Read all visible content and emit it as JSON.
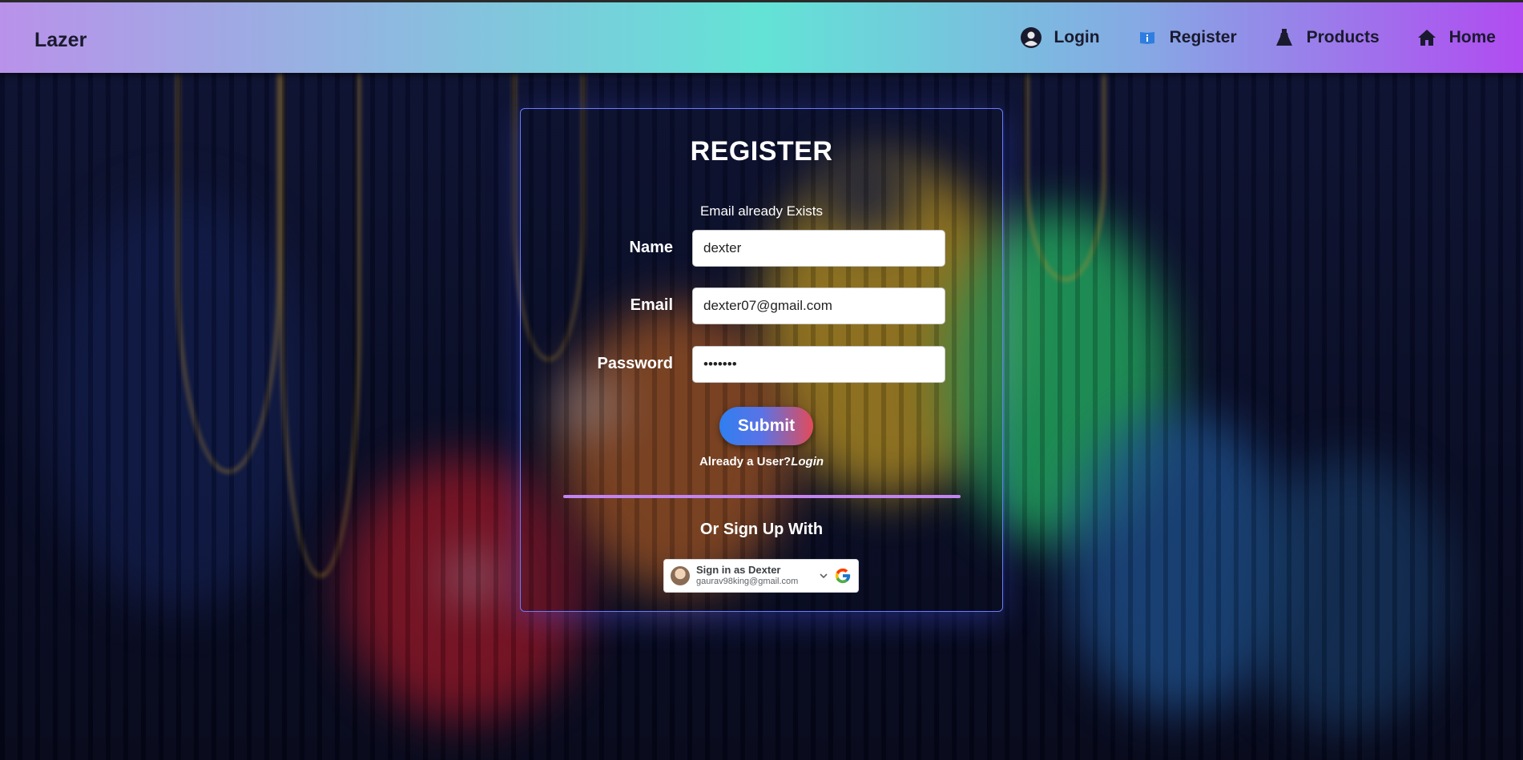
{
  "navbar": {
    "brand": "Lazer",
    "items": [
      {
        "label": "Login",
        "icon": "user-circle-icon"
      },
      {
        "label": "Register",
        "icon": "info-book-icon"
      },
      {
        "label": "Products",
        "icon": "dress-icon"
      },
      {
        "label": "Home",
        "icon": "home-icon"
      }
    ]
  },
  "register_form": {
    "title": "REGISTER",
    "error_message": "Email already Exists",
    "fields": {
      "name": {
        "label": "Name",
        "value": "dexter"
      },
      "email": {
        "label": "Email",
        "value": "dexter07@gmail.com"
      },
      "password": {
        "label": "Password",
        "value": "•••••••"
      }
    },
    "submit_label": "Submit",
    "already_user_text": "Already a User?",
    "login_link_text": "Login",
    "or_sign_up_text": "Or Sign Up With"
  },
  "google_signin": {
    "title": "Sign in as Dexter",
    "email": "gaurav98king@gmail.com"
  },
  "colors": {
    "accent_divider": "#c184f0",
    "card_border": "#6b7bff",
    "submit_start": "#2f7ff0",
    "submit_end": "#e24b5a"
  }
}
